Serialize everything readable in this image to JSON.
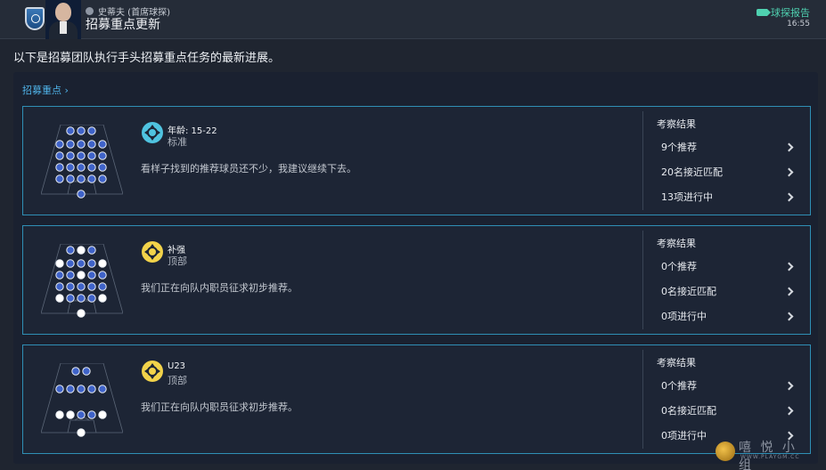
{
  "header": {
    "sender": "史蒂夫 (首席球探)",
    "title": "招募重点更新",
    "report_link": "球探报告",
    "time": "16:55"
  },
  "intro": "以下是招募团队执行手头招募重点任务的最新进展。",
  "section_link": "招募重点",
  "cards": [
    {
      "title": "年龄: 15-22",
      "subtitle": "标准",
      "description": "看样子找到的推荐球员还不少，我建议继续下去。",
      "icon_color": "#4fc3e0",
      "results_title": "考察结果",
      "results": [
        "9个推荐",
        "20名接近匹配",
        "13项进行中"
      ]
    },
    {
      "title": "补强",
      "subtitle": "顶部",
      "description": "我们正在向队内职员征求初步推荐。",
      "icon_color": "#f2d34a",
      "results_title": "考察结果",
      "results": [
        "0个推荐",
        "0名接近匹配",
        "0项进行中"
      ]
    },
    {
      "title": "U23",
      "subtitle": "顶部",
      "description": "我们正在向队内职员征求初步推荐。",
      "icon_color": "#f2d34a",
      "results_title": "考察结果",
      "results": [
        "0个推荐",
        "0名接近匹配",
        "0项进行中"
      ]
    }
  ],
  "watermark": {
    "text": "嘻 悦 小 组",
    "sub": "WWW.PLAYGM.CC"
  }
}
